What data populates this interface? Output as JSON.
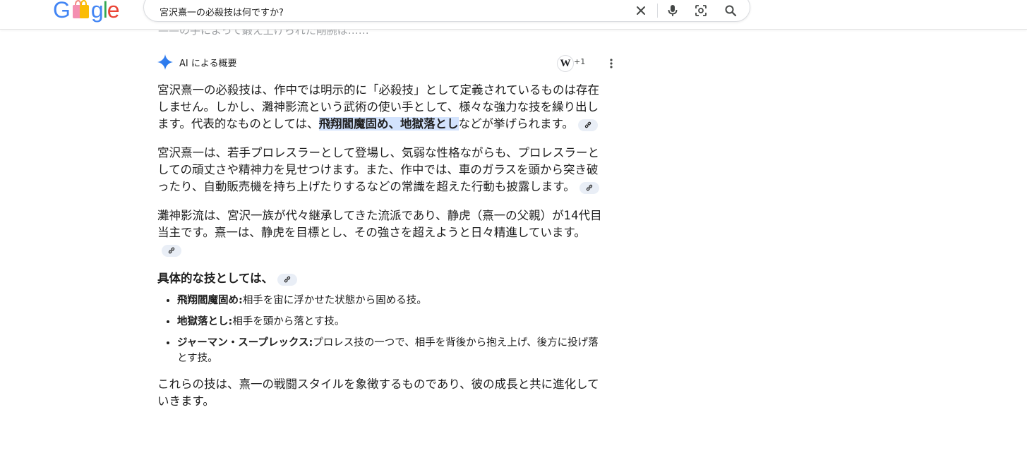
{
  "header": {
    "logo_text": "Google",
    "search": {
      "value": "宮沢熹一の必殺技は何ですか?",
      "placeholder": ""
    },
    "icons": [
      "close-icon",
      "microphone-icon",
      "lens-icon",
      "search-icon"
    ]
  },
  "faded_line": "——の手によって鍛え上げられた剛腕は……",
  "ai_overview": {
    "title": "AI による概要",
    "source_badge": "W",
    "source_count": "+1",
    "paragraphs": [
      {
        "before": "宮沢熹一の必殺技は、作中では明示的に「必殺技」として定義されているものは存在しません。しかし、灘神影流という武術の使い手として、様々な強力な技を繰り出します。代表的なものとしては、",
        "highlight": "飛翔閻魔固め、地獄落とし",
        "after": "などが挙げられます。"
      },
      {
        "text": "宮沢熹一は、若手プロレスラーとして登場し、気弱な性格ながらも、プロレスラーとしての頑丈さや精神力を見せつけます。また、作中では、車のガラスを頭から突き破ったり、自動販売機を持ち上げたりするなどの常識を超えた行動も披露します。"
      },
      {
        "text": "灘神影流は、宮沢一族が代々継承してきた流派であり、静虎（熹一の父親）が14代目当主です。熹一は、静虎を目標とし、その強さを超えようと日々精進しています。"
      }
    ],
    "subheading": "具体的な技としては、",
    "techniques": [
      {
        "name": "飛翔閻魔固め:",
        "desc": "相手を宙に浮かせた状態から固める技。"
      },
      {
        "name": "地獄落とし:",
        "desc": "相手を頭から落とす技。"
      },
      {
        "name": "ジャーマン・スープレックス:",
        "desc": "プロレス技の一つで、相手を背後から抱え上げ、後方に投げ落とす技。"
      }
    ],
    "closing": "これらの技は、熹一の戦闘スタイルを象徴するものであり、彼の成長と共に進化していきます。"
  },
  "colors": {
    "accent_blue": "#4285f4",
    "highlight_bg": "#d3e3fd",
    "cite_bg": "#e9eef6"
  }
}
